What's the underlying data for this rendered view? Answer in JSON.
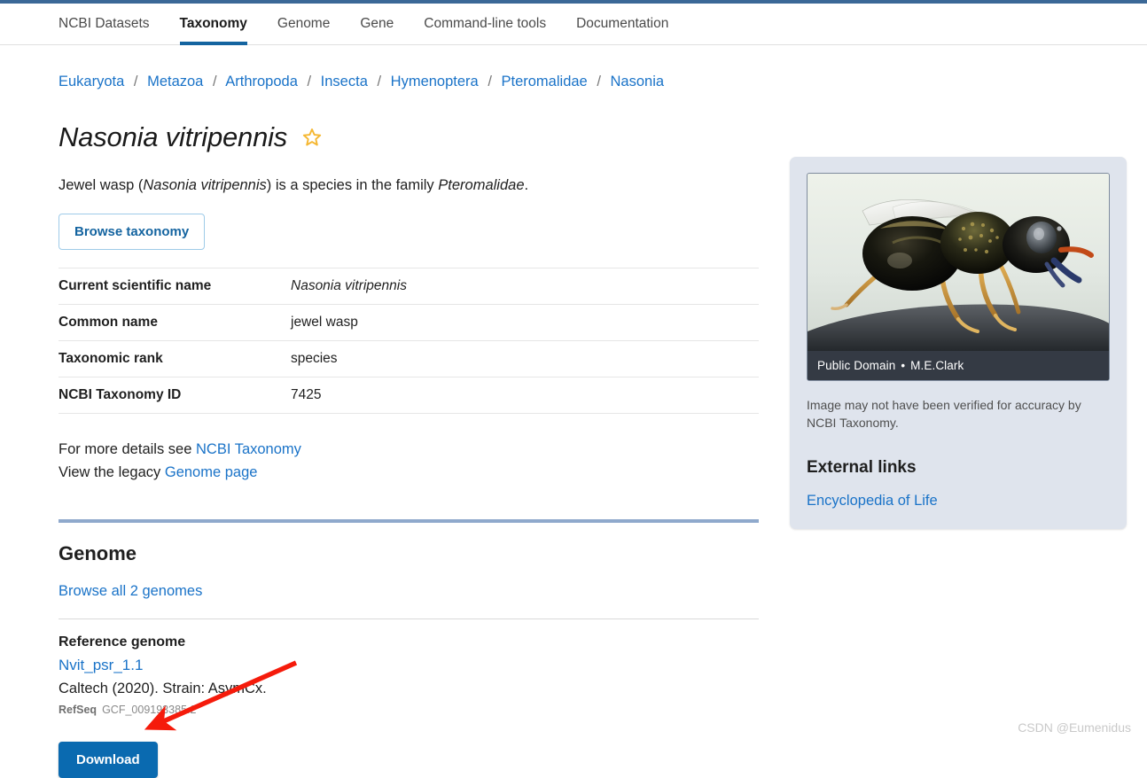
{
  "nav": {
    "items": [
      {
        "label": "NCBI Datasets",
        "active": false
      },
      {
        "label": "Taxonomy",
        "active": true
      },
      {
        "label": "Genome",
        "active": false
      },
      {
        "label": "Gene",
        "active": false
      },
      {
        "label": "Command-line tools",
        "active": false
      },
      {
        "label": "Documentation",
        "active": false
      }
    ]
  },
  "breadcrumb": {
    "separator": "/",
    "items": [
      "Eukaryota",
      "Metazoa",
      "Arthropoda",
      "Insecta",
      "Hymenoptera",
      "Pteromalidae",
      "Nasonia"
    ]
  },
  "header": {
    "title": "Nasonia vitripennis",
    "star_icon": "star-outline-icon",
    "star_color": "#f5b731"
  },
  "lede": {
    "part1": "Jewel wasp (",
    "species_italic": "Nasonia vitripennis",
    "part2": ") is a species in the family ",
    "family_italic": "Pteromalidae",
    "part3": "."
  },
  "buttons": {
    "browse_taxonomy": "Browse taxonomy",
    "download": "Download"
  },
  "info_table": {
    "rows": [
      {
        "label": "Current scientific name",
        "value": "Nasonia vitripennis",
        "italic": true
      },
      {
        "label": "Common name",
        "value": "jewel wasp",
        "italic": false
      },
      {
        "label": "Taxonomic rank",
        "value": "species",
        "italic": false
      },
      {
        "label": "NCBI Taxonomy ID",
        "value": "7425",
        "italic": false
      }
    ]
  },
  "details": {
    "line1_prefix": "For more details see ",
    "line1_link": "NCBI Taxonomy",
    "line2_prefix": "View the legacy ",
    "line2_link": "Genome page"
  },
  "genome": {
    "section_title": "Genome",
    "browse_all": "Browse all 2 genomes",
    "reference_label": "Reference genome",
    "assembly_name": "Nvit_psr_1.1",
    "assembly_sub": "Caltech (2020). Strain: AsymCx.",
    "refseq_label": "RefSeq",
    "refseq_accession": "GCF_009193385.2"
  },
  "sidebar": {
    "photo_caption_license": "Public Domain",
    "photo_caption_sep": "•",
    "photo_caption_author": "M.E.Clark",
    "photo_alt": "jewel wasp photograph",
    "disclaimer": "Image may not have been verified for accuracy by NCBI Taxonomy.",
    "external_links_title": "External links",
    "external_links": [
      "Encyclopedia of Life"
    ]
  },
  "annotation": {
    "arrow_color": "#f51b0b"
  },
  "watermark": {
    "text": "CSDN @Eumenidus"
  },
  "colors": {
    "link": "#1a73c8",
    "primary_button": "#0a6ab0",
    "active_tab_underline": "#1464a0",
    "panel_background": "#dfe4ed",
    "section_rule": "#8fa9cc",
    "top_strip": "#3b6897"
  }
}
